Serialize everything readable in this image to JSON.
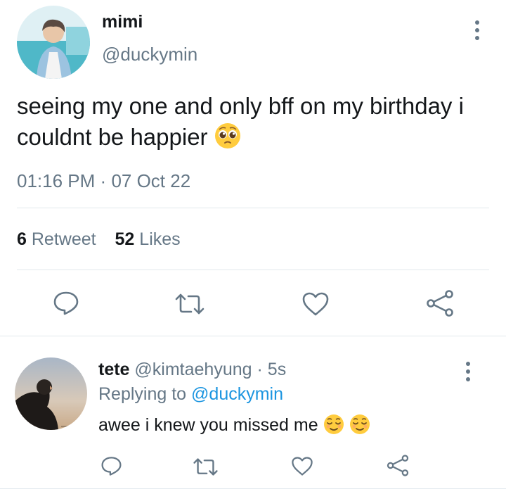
{
  "tweet": {
    "display_name": "mimi",
    "handle": "@duckymin",
    "text": "seeing my one and only bff on my birthday i couldnt be happier",
    "emoji": "pleading-face",
    "time": "01:16 PM",
    "separator": "·",
    "date": "07 Oct 22",
    "retweet_count": "6",
    "retweet_label": "Retweet",
    "likes_count": "52",
    "likes_label": "Likes"
  },
  "reply": {
    "display_name": "tete",
    "handle": "@kimtaehyung",
    "separator": "·",
    "time_ago": "5s",
    "replying_to_label": "Replying to",
    "replying_to_handle": "@duckymin",
    "text": "awee i knew you missed me",
    "emojis": [
      "relieved-face",
      "relieved-face"
    ]
  },
  "icons": [
    "reply-icon",
    "retweet-icon",
    "like-icon",
    "share-icon",
    "more-options-icon"
  ],
  "colors": {
    "link": "#1b95e0",
    "secondary_text": "#657786",
    "divider": "#e1e8ed",
    "icon": "#657786"
  }
}
